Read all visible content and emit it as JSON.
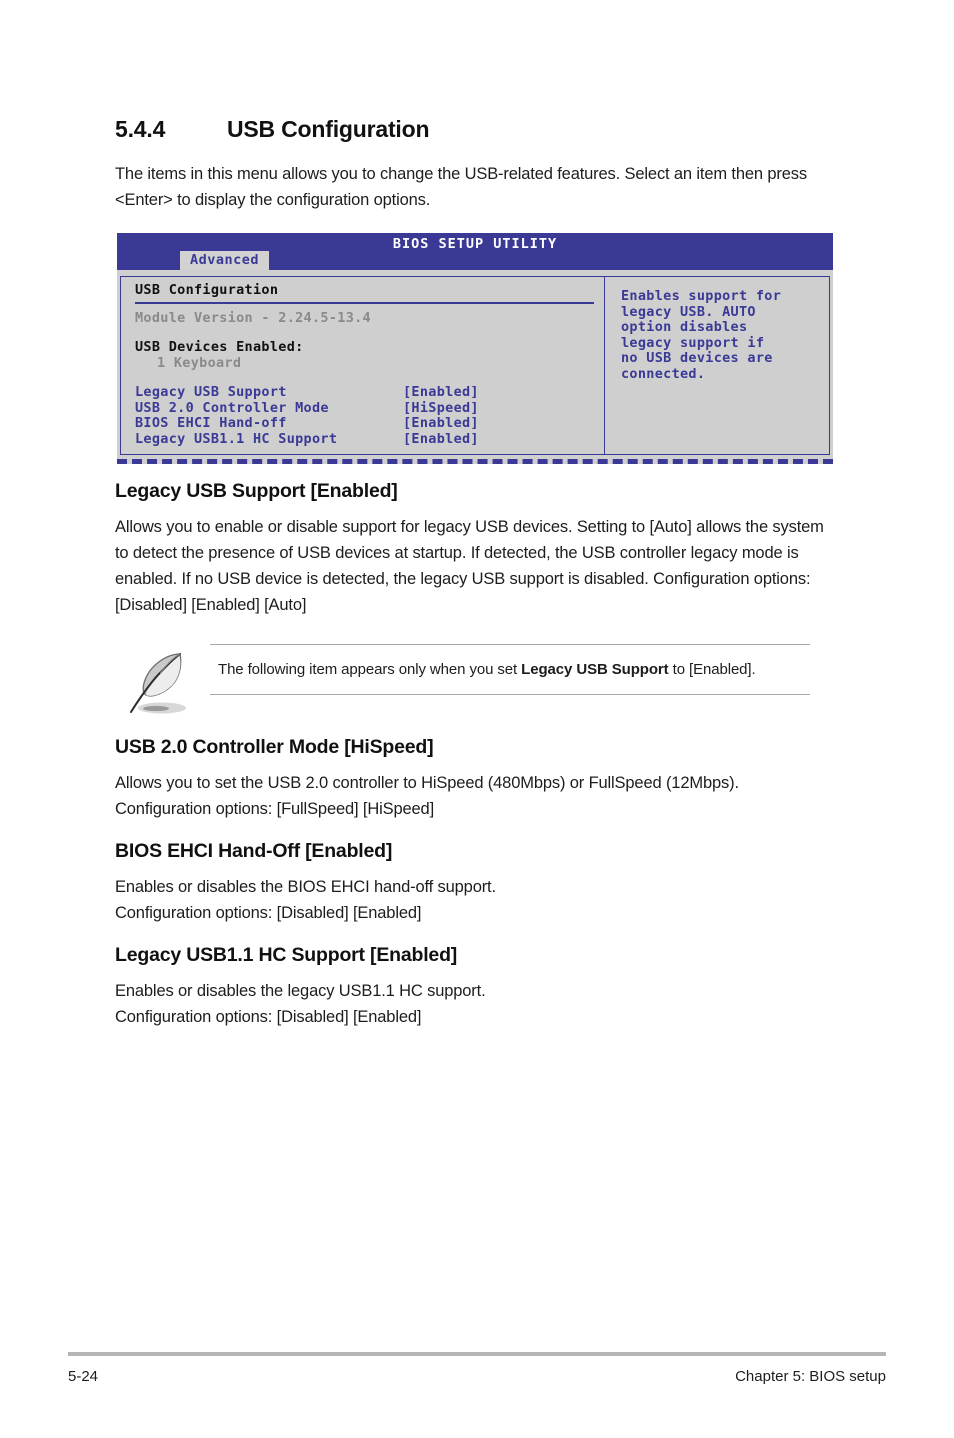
{
  "section": {
    "number": "5.4.4",
    "title": "USB Configuration",
    "intro": "The items in this menu allows you to change the USB-related features. Select an item then press <Enter> to display the configuration options."
  },
  "bios_screen": {
    "title": "BIOS SETUP UTILITY",
    "active_tab": "Advanced",
    "panel_heading": "USB Configuration",
    "module_version": "Module Version - 2.24.5-13.4",
    "devices_label": "USB Devices Enabled:",
    "devices_value": "1 Keyboard",
    "settings": [
      {
        "name": "Legacy USB Support",
        "value": "[Enabled]"
      },
      {
        "name": "USB 2.0 Controller Mode",
        "value": "[HiSpeed]"
      },
      {
        "name": "BIOS EHCI Hand-off",
        "value": "[Enabled]"
      },
      {
        "name": "Legacy USB1.1 HC Support",
        "value": "[Enabled]"
      }
    ],
    "help_lines": [
      "Enables support for",
      "legacy USB. AUTO",
      "option disables",
      "legacy support if",
      "no USB devices are",
      "connected."
    ],
    "colors": {
      "header_blue": "#3a3a96",
      "panel_gray": "#cfcfcf",
      "tab_gray": "#d2d2d2",
      "dim_text": "#8a8a8a"
    }
  },
  "items": [
    {
      "heading": "Legacy USB Support [Enabled]",
      "body": "Allows you to enable or disable support for legacy USB devices. Setting to [Auto] allows the system to detect the presence of USB devices at startup. If detected, the USB controller legacy mode is enabled. If no USB device is detected, the legacy USB support is disabled. Configuration options: [Disabled] [Enabled] [Auto]"
    },
    {
      "heading": "USB 2.0 Controller Mode [HiSpeed]",
      "body": "Allows you to set the USB 2.0 controller to HiSpeed (480Mbps) or FullSpeed (12Mbps). Configuration options: [FullSpeed] [HiSpeed]"
    },
    {
      "heading": "BIOS EHCI Hand-Off [Enabled]",
      "body_line1": "Enables or disables the BIOS EHCI hand-off support.",
      "body_line2": "Configuration options: [Disabled] [Enabled]"
    },
    {
      "heading": "Legacy USB1.1 HC Support [Enabled]",
      "body_line1": "Enables or disables the legacy USB1.1 HC support.",
      "body_line2": "Configuration options: [Disabled] [Enabled]"
    }
  ],
  "note": {
    "text_before": "The following item appears only when you set ",
    "text_bold": "Legacy USB Support",
    "text_after": " to [Enabled]."
  },
  "footer": {
    "page_number": "5-24",
    "chapter": "Chapter 5: BIOS setup"
  }
}
